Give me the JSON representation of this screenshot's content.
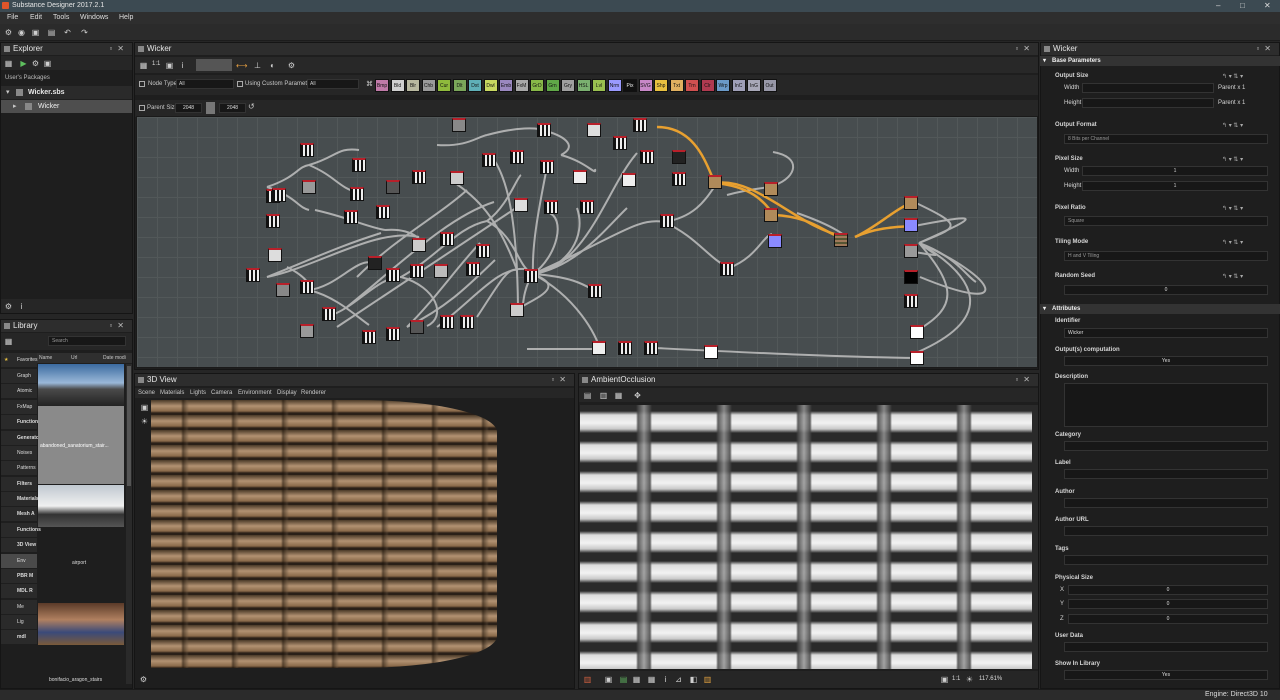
{
  "app": {
    "title": "Substance Designer 2017.2.1",
    "engine": "Engine: Direct3D 10"
  },
  "menu": [
    "File",
    "Edit",
    "Tools",
    "Windows",
    "Help"
  ],
  "explorer": {
    "title": "Explorer",
    "section": "User's Packages",
    "package": "Wicker.sbs",
    "graph": "Wicker"
  },
  "graph": {
    "title": "Wicker",
    "zoom": "1:1",
    "node_type_label": "Node Type",
    "node_type_value": "All",
    "custom_params_label": "Using Custom Parameters",
    "custom_params_value": "All",
    "parent_size_label": "Parent Size:",
    "parent_w": "2048",
    "parent_h": "2048",
    "filters": [
      {
        "label": "Bmp",
        "color": "#c07aa8"
      },
      {
        "label": "Bld",
        "color": "#d0d0d0"
      },
      {
        "label": "Blr",
        "color": "#b8b8a0"
      },
      {
        "label": "Chb",
        "color": "#9a9a9a"
      },
      {
        "label": "Cur",
        "color": "#8fba3c"
      },
      {
        "label": "Dlt",
        "color": "#7aa65a"
      },
      {
        "label": "Dxt",
        "color": "#5fb0b8"
      },
      {
        "label": "Dwl",
        "color": "#c8d860"
      },
      {
        "label": "Emb",
        "color": "#9a88c0"
      },
      {
        "label": "FxM",
        "color": "#a8a8a8"
      },
      {
        "label": "GrD",
        "color": "#88b848"
      },
      {
        "label": "Grn",
        "color": "#60a848"
      },
      {
        "label": "Gry",
        "color": "#a0a0a0"
      },
      {
        "label": "HSL",
        "color": "#7ab070"
      },
      {
        "label": "Lvl",
        "color": "#9ac050"
      },
      {
        "label": "Nrm",
        "color": "#9a9aff"
      },
      {
        "label": "Pix",
        "color": "#101010"
      },
      {
        "label": "SVG",
        "color": "#c888c8"
      },
      {
        "label": "Shp",
        "color": "#e8c040"
      },
      {
        "label": "Txt",
        "color": "#e0b060"
      },
      {
        "label": "Trn",
        "color": "#d05050"
      },
      {
        "label": "Clr",
        "color": "#b03a50"
      },
      {
        "label": "Wrp",
        "color": "#6a9ac8"
      },
      {
        "label": "InC",
        "color": "#a0a0b8"
      },
      {
        "label": "InG",
        "color": "#a8a8b8"
      },
      {
        "label": "Out",
        "color": "#9898a8"
      }
    ]
  },
  "view3d": {
    "title": "3D View",
    "menu": [
      "Scene",
      "Materials",
      "Lights",
      "Camera",
      "Environment",
      "Display",
      "Renderer"
    ]
  },
  "view2d": {
    "title": "AmbientOcclusion",
    "zoom_value": "1:1",
    "zoom_pct": "117.61%"
  },
  "library": {
    "title": "Library",
    "search_placeholder": "Search",
    "cols": [
      "Name",
      "Url",
      "Date modi"
    ],
    "cats": [
      "Favorites",
      "Graph",
      "Atomic",
      "FxMap",
      "Function",
      "Generators",
      "Noises",
      "Patterns",
      "Filters",
      "Materials",
      "Mesh A",
      "Functions",
      "3D View",
      "Env",
      "PBR M",
      "MDL R",
      "Me",
      "Lig",
      "mdl"
    ],
    "items": [
      "abandoned_sanatorium_stair...",
      "airport",
      "bonifacio_aragon_stairs"
    ]
  },
  "props": {
    "title": "Wicker",
    "base_section": "Base Parameters",
    "output_size": "Output Size",
    "width_label": "Width",
    "height_label": "Height",
    "parent_x1": "Parent x 1",
    "output_format": "Output Format",
    "format_value": "8 Bits per Channel",
    "pixel_size": "Pixel Size",
    "ps_w": "1",
    "ps_h": "1",
    "pixel_ratio": "Pixel Ratio",
    "ratio_value": "Square",
    "tiling_mode": "Tiling Mode",
    "tiling_value": "H and V Tiling",
    "random_seed": "Random Seed",
    "seed_value": "0",
    "attr_section": "Attributes",
    "identifier": "Identifier",
    "identifier_value": "Wicker",
    "outputs_comp": "Output(s) computation",
    "outputs_value": "Yes",
    "description": "Description",
    "category": "Category",
    "label": "Label",
    "author": "Author",
    "author_url": "Author URL",
    "tags": "Tags",
    "physical_size": "Physical Size",
    "x_label": "X",
    "y_label": "Y",
    "z_label": "Z",
    "phys_x": "0",
    "phys_y": "0",
    "phys_z": "0",
    "user_data": "User Data",
    "show_in_library": "Show In Library",
    "show_value": "Yes"
  }
}
